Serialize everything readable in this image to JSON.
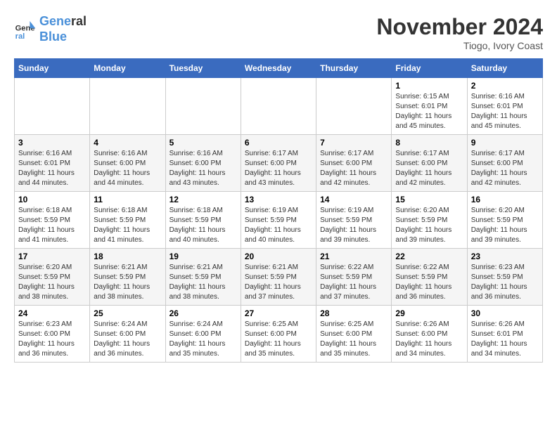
{
  "logo": {
    "line1": "General",
    "line2": "Blue"
  },
  "title": "November 2024",
  "location": "Tiogo, Ivory Coast",
  "days_of_week": [
    "Sunday",
    "Monday",
    "Tuesday",
    "Wednesday",
    "Thursday",
    "Friday",
    "Saturday"
  ],
  "weeks": [
    [
      {
        "day": "",
        "info": ""
      },
      {
        "day": "",
        "info": ""
      },
      {
        "day": "",
        "info": ""
      },
      {
        "day": "",
        "info": ""
      },
      {
        "day": "",
        "info": ""
      },
      {
        "day": "1",
        "info": "Sunrise: 6:15 AM\nSunset: 6:01 PM\nDaylight: 11 hours and 45 minutes."
      },
      {
        "day": "2",
        "info": "Sunrise: 6:16 AM\nSunset: 6:01 PM\nDaylight: 11 hours and 45 minutes."
      }
    ],
    [
      {
        "day": "3",
        "info": "Sunrise: 6:16 AM\nSunset: 6:01 PM\nDaylight: 11 hours and 44 minutes."
      },
      {
        "day": "4",
        "info": "Sunrise: 6:16 AM\nSunset: 6:00 PM\nDaylight: 11 hours and 44 minutes."
      },
      {
        "day": "5",
        "info": "Sunrise: 6:16 AM\nSunset: 6:00 PM\nDaylight: 11 hours and 43 minutes."
      },
      {
        "day": "6",
        "info": "Sunrise: 6:17 AM\nSunset: 6:00 PM\nDaylight: 11 hours and 43 minutes."
      },
      {
        "day": "7",
        "info": "Sunrise: 6:17 AM\nSunset: 6:00 PM\nDaylight: 11 hours and 42 minutes."
      },
      {
        "day": "8",
        "info": "Sunrise: 6:17 AM\nSunset: 6:00 PM\nDaylight: 11 hours and 42 minutes."
      },
      {
        "day": "9",
        "info": "Sunrise: 6:17 AM\nSunset: 6:00 PM\nDaylight: 11 hours and 42 minutes."
      }
    ],
    [
      {
        "day": "10",
        "info": "Sunrise: 6:18 AM\nSunset: 5:59 PM\nDaylight: 11 hours and 41 minutes."
      },
      {
        "day": "11",
        "info": "Sunrise: 6:18 AM\nSunset: 5:59 PM\nDaylight: 11 hours and 41 minutes."
      },
      {
        "day": "12",
        "info": "Sunrise: 6:18 AM\nSunset: 5:59 PM\nDaylight: 11 hours and 40 minutes."
      },
      {
        "day": "13",
        "info": "Sunrise: 6:19 AM\nSunset: 5:59 PM\nDaylight: 11 hours and 40 minutes."
      },
      {
        "day": "14",
        "info": "Sunrise: 6:19 AM\nSunset: 5:59 PM\nDaylight: 11 hours and 39 minutes."
      },
      {
        "day": "15",
        "info": "Sunrise: 6:20 AM\nSunset: 5:59 PM\nDaylight: 11 hours and 39 minutes."
      },
      {
        "day": "16",
        "info": "Sunrise: 6:20 AM\nSunset: 5:59 PM\nDaylight: 11 hours and 39 minutes."
      }
    ],
    [
      {
        "day": "17",
        "info": "Sunrise: 6:20 AM\nSunset: 5:59 PM\nDaylight: 11 hours and 38 minutes."
      },
      {
        "day": "18",
        "info": "Sunrise: 6:21 AM\nSunset: 5:59 PM\nDaylight: 11 hours and 38 minutes."
      },
      {
        "day": "19",
        "info": "Sunrise: 6:21 AM\nSunset: 5:59 PM\nDaylight: 11 hours and 38 minutes."
      },
      {
        "day": "20",
        "info": "Sunrise: 6:21 AM\nSunset: 5:59 PM\nDaylight: 11 hours and 37 minutes."
      },
      {
        "day": "21",
        "info": "Sunrise: 6:22 AM\nSunset: 5:59 PM\nDaylight: 11 hours and 37 minutes."
      },
      {
        "day": "22",
        "info": "Sunrise: 6:22 AM\nSunset: 5:59 PM\nDaylight: 11 hours and 36 minutes."
      },
      {
        "day": "23",
        "info": "Sunrise: 6:23 AM\nSunset: 5:59 PM\nDaylight: 11 hours and 36 minutes."
      }
    ],
    [
      {
        "day": "24",
        "info": "Sunrise: 6:23 AM\nSunset: 6:00 PM\nDaylight: 11 hours and 36 minutes."
      },
      {
        "day": "25",
        "info": "Sunrise: 6:24 AM\nSunset: 6:00 PM\nDaylight: 11 hours and 36 minutes."
      },
      {
        "day": "26",
        "info": "Sunrise: 6:24 AM\nSunset: 6:00 PM\nDaylight: 11 hours and 35 minutes."
      },
      {
        "day": "27",
        "info": "Sunrise: 6:25 AM\nSunset: 6:00 PM\nDaylight: 11 hours and 35 minutes."
      },
      {
        "day": "28",
        "info": "Sunrise: 6:25 AM\nSunset: 6:00 PM\nDaylight: 11 hours and 35 minutes."
      },
      {
        "day": "29",
        "info": "Sunrise: 6:26 AM\nSunset: 6:00 PM\nDaylight: 11 hours and 34 minutes."
      },
      {
        "day": "30",
        "info": "Sunrise: 6:26 AM\nSunset: 6:01 PM\nDaylight: 11 hours and 34 minutes."
      }
    ]
  ]
}
